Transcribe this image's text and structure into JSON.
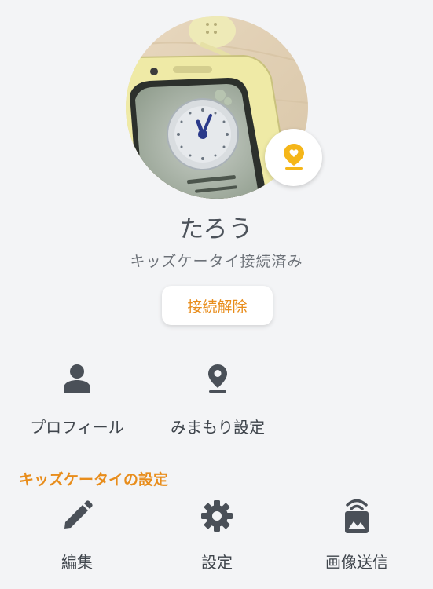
{
  "profile": {
    "name": "たろう",
    "status": "キッズケータイ接続済み",
    "disconnect_label": "接続解除",
    "photo_icon": "kids-phone-photo",
    "badge_icon": "heart-location-pin-icon"
  },
  "actions": [
    {
      "label": "プロフィール",
      "icon": "person-icon"
    },
    {
      "label": "みまもり設定",
      "icon": "location-pin-icon"
    }
  ],
  "settings_section": {
    "title": "キッズケータイの設定",
    "items": [
      {
        "label": "編集",
        "icon": "pencil-icon"
      },
      {
        "label": "設定",
        "icon": "gear-icon"
      },
      {
        "label": "画像送信",
        "icon": "image-send-icon"
      }
    ]
  },
  "colors": {
    "accent": "#e88d1c",
    "background": "#f3f4f6",
    "icon": "#4a5058",
    "badge": "#f5b619"
  }
}
